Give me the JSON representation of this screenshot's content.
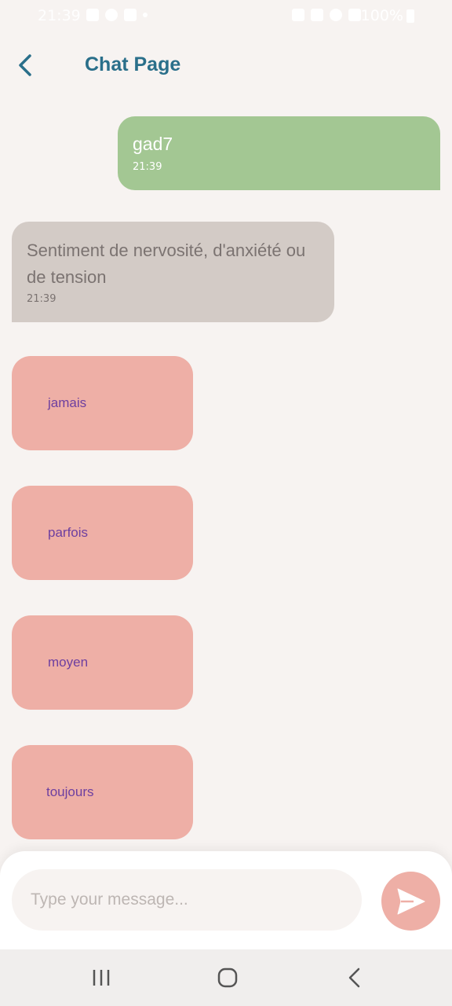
{
  "status_bar": {
    "time": "21:39",
    "battery": "100%",
    "icons": [
      "gallery-icon",
      "messenger-icon",
      "facebook-icon",
      "dot-icon",
      "nfc-icon",
      "mute-icon",
      "wifi-icon",
      "signal-icon",
      "battery-icon"
    ]
  },
  "header": {
    "title": "Chat Page",
    "back_icon": "chevron-left-icon",
    "accent_color": "#2A6F8A"
  },
  "messages": [
    {
      "sender": "user",
      "text": "gad7",
      "time": "21:39",
      "color": "#A3C793"
    },
    {
      "sender": "bot",
      "text": "Sentiment de nervosité, d'anxiété ou de tension",
      "time": "21:39",
      "color": "#D3CBC6"
    }
  ],
  "options": [
    {
      "label": "jamais"
    },
    {
      "label": "parfois"
    },
    {
      "label": "moyen"
    },
    {
      "label": "toujours"
    }
  ],
  "options_style": {
    "background": "#EEAFA6",
    "text_color": "#6D3FA0"
  },
  "composer": {
    "placeholder": "Type your message...",
    "send_icon": "send-icon"
  },
  "nav": {
    "icons": [
      "recents-icon",
      "home-icon",
      "back-icon"
    ]
  }
}
